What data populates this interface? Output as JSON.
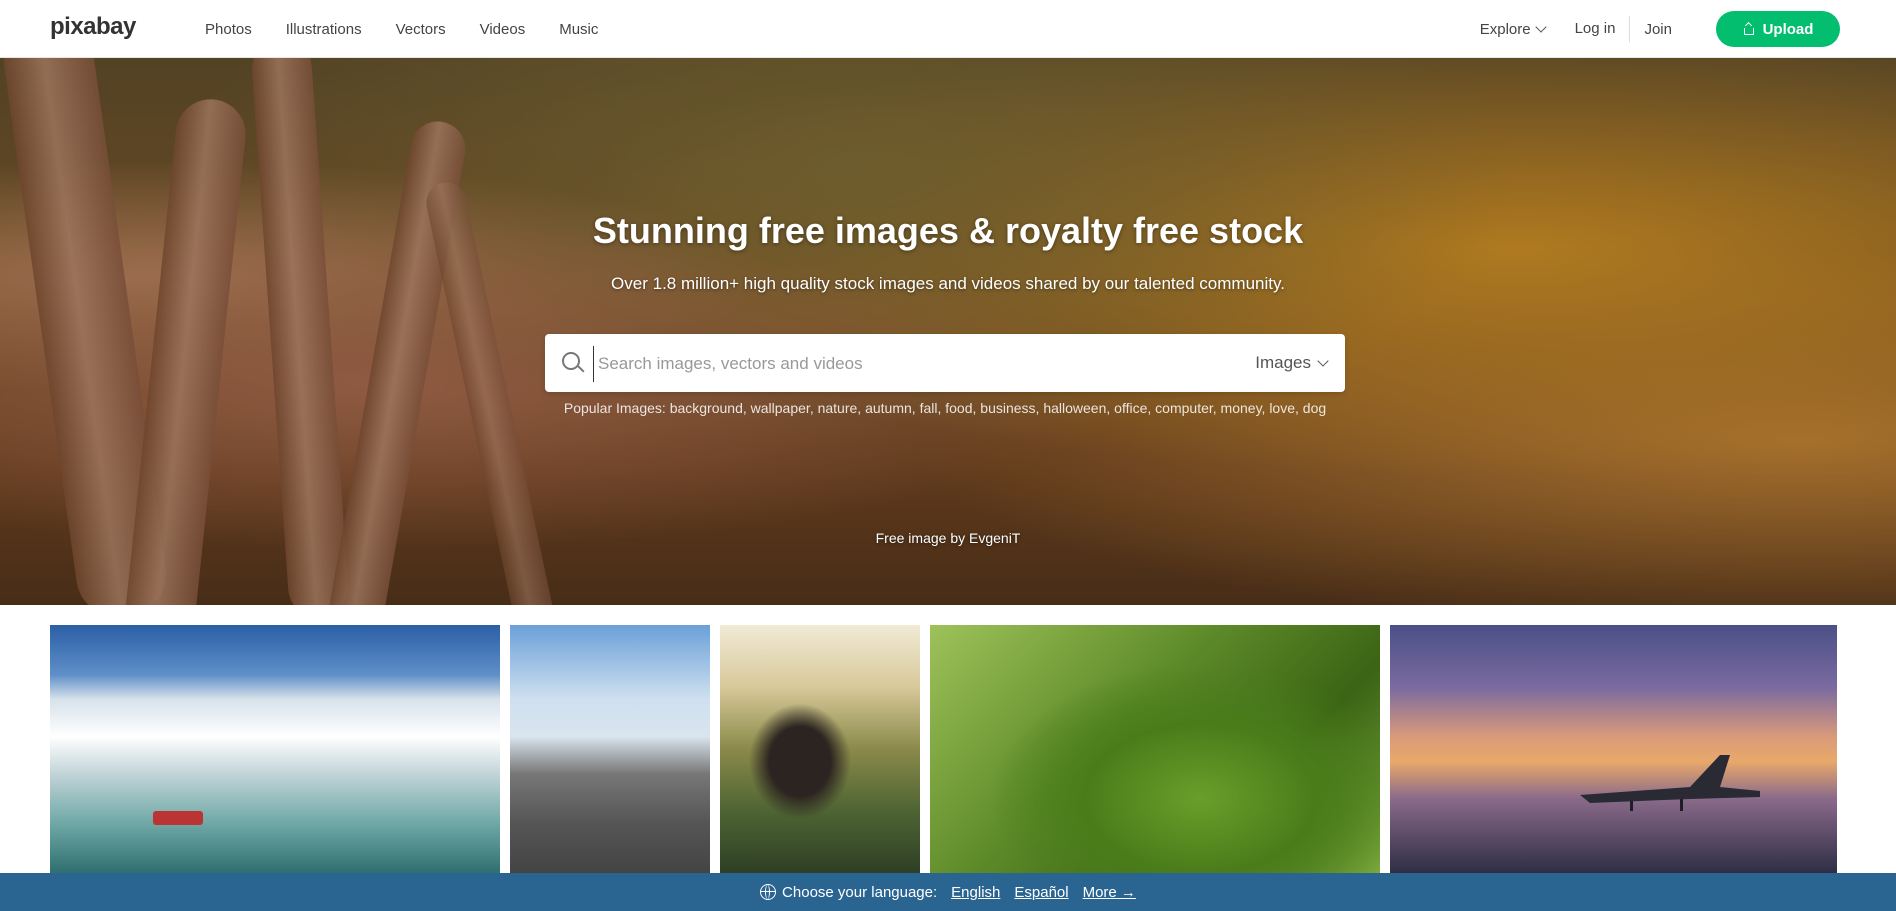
{
  "header": {
    "logo": "pixabay",
    "nav": [
      "Photos",
      "Illustrations",
      "Vectors",
      "Videos",
      "Music"
    ],
    "explore": "Explore",
    "login": "Log in",
    "join": "Join",
    "upload": "Upload"
  },
  "hero": {
    "title": "Stunning free images & royalty free stock",
    "subtitle": "Over 1.8 million+ high quality stock images and videos shared by our talented community.",
    "search_placeholder": "Search images, vectors and videos",
    "search_type": "Images",
    "popular_label": "Popular Images:",
    "popular_tags": [
      "background",
      "wallpaper",
      "nature",
      "autumn",
      "fall",
      "food",
      "business",
      "halloween",
      "office",
      "computer",
      "money",
      "love",
      "dog"
    ],
    "credit": "Free image by EvgeniT"
  },
  "language_bar": {
    "label": "Choose your language:",
    "options": [
      "English",
      "Español"
    ],
    "more": "More →"
  },
  "colors": {
    "accent": "#02be6e",
    "language_bar": "#2a6491"
  }
}
